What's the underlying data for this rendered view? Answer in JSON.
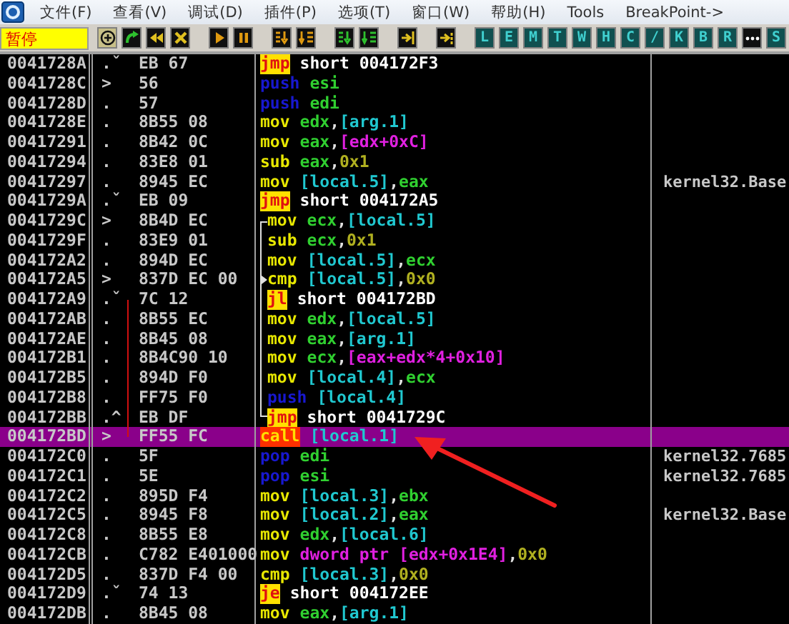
{
  "menu": [
    "文件(F)",
    "查看(V)",
    "调试(D)",
    "插件(P)",
    "选项(T)",
    "窗口(W)",
    "帮助(H)",
    "Tools",
    "BreakPoint->"
  ],
  "status": "暂停",
  "toolbar_letters": [
    {
      "kind": "letter",
      "label": "L"
    },
    {
      "kind": "letter",
      "label": "E"
    },
    {
      "kind": "letter",
      "label": "M"
    },
    {
      "kind": "letter",
      "label": "T"
    },
    {
      "kind": "letter",
      "label": "W"
    },
    {
      "kind": "letter",
      "label": "H"
    },
    {
      "kind": "letter",
      "label": "C"
    },
    {
      "kind": "letter",
      "label": "/"
    },
    {
      "kind": "letter",
      "label": "K"
    },
    {
      "kind": "letter",
      "label": "B"
    },
    {
      "kind": "letter",
      "label": "R"
    },
    {
      "kind": "dots"
    },
    {
      "kind": "letter",
      "label": "S"
    }
  ],
  "rows": [
    {
      "address": "0041728A",
      "marker": ".ˇ",
      "hex": "EB 67",
      "mnemonic": {
        "text": "jmp",
        "kind": "jump"
      },
      "operands": [
        {
          "text": "short 004172F3",
          "kind": "addr"
        }
      ],
      "selected": false
    },
    {
      "address": "0041728C",
      "marker": ">",
      "hex": "56",
      "mnemonic": {
        "text": "push",
        "kind": "stack"
      },
      "operands": [
        {
          "text": "esi",
          "kind": "reg"
        }
      ],
      "selected": false
    },
    {
      "address": "0041728D",
      "marker": ".",
      "hex": "57",
      "mnemonic": {
        "text": "push",
        "kind": "stack"
      },
      "operands": [
        {
          "text": "edi",
          "kind": "reg"
        }
      ],
      "selected": false
    },
    {
      "address": "0041728E",
      "marker": ".",
      "hex": "8B55 08",
      "mnemonic": {
        "text": "mov",
        "kind": "plain"
      },
      "operands": [
        {
          "text": "edx",
          "kind": "reg"
        },
        {
          "text": ",",
          "kind": "punct"
        },
        {
          "text": "[arg.1]",
          "kind": "mem"
        }
      ],
      "selected": false
    },
    {
      "address": "00417291",
      "marker": ".",
      "hex": "8B42 0C",
      "mnemonic": {
        "text": "mov",
        "kind": "plain"
      },
      "operands": [
        {
          "text": "eax",
          "kind": "reg"
        },
        {
          "text": ",",
          "kind": "punct"
        },
        {
          "text": "[edx+0xC]",
          "kind": "ptr"
        }
      ],
      "selected": false
    },
    {
      "address": "00417294",
      "marker": ".",
      "hex": "83E8 01",
      "mnemonic": {
        "text": "sub",
        "kind": "plain"
      },
      "operands": [
        {
          "text": "eax",
          "kind": "reg"
        },
        {
          "text": ",",
          "kind": "punct"
        },
        {
          "text": "0x1",
          "kind": "imm"
        }
      ],
      "selected": false
    },
    {
      "address": "00417297",
      "marker": ".",
      "hex": "8945 EC",
      "mnemonic": {
        "text": "mov",
        "kind": "plain"
      },
      "operands": [
        {
          "text": "[local.5]",
          "kind": "mem"
        },
        {
          "text": ",",
          "kind": "punct"
        },
        {
          "text": "eax",
          "kind": "reg"
        }
      ],
      "comment": "kernel32.Base",
      "selected": false
    },
    {
      "address": "0041729A",
      "marker": ".ˇ",
      "hex": "EB 09",
      "mnemonic": {
        "text": "jmp",
        "kind": "jump"
      },
      "operands": [
        {
          "text": "short 004172A5",
          "kind": "addr"
        }
      ],
      "selected": false
    },
    {
      "address": "0041729C",
      "marker": ">",
      "hex": "8B4D EC",
      "bracket": {
        "kind": "top"
      },
      "mnemonic": {
        "text": "mov",
        "kind": "plain"
      },
      "operands": [
        {
          "text": "ecx",
          "kind": "reg"
        },
        {
          "text": ",",
          "kind": "punct"
        },
        {
          "text": "[local.5]",
          "kind": "mem"
        }
      ],
      "selected": false
    },
    {
      "address": "0041729F",
      "marker": ".",
      "hex": "83E9 01",
      "bracket": {
        "kind": "mid"
      },
      "mnemonic": {
        "text": "sub",
        "kind": "plain"
      },
      "operands": [
        {
          "text": "ecx",
          "kind": "reg"
        },
        {
          "text": ",",
          "kind": "punct"
        },
        {
          "text": "0x1",
          "kind": "imm"
        }
      ],
      "selected": false
    },
    {
      "address": "004172A2",
      "marker": ".",
      "hex": "894D EC",
      "bracket": {
        "kind": "mid"
      },
      "mnemonic": {
        "text": "mov",
        "kind": "plain"
      },
      "operands": [
        {
          "text": "[local.5]",
          "kind": "mem"
        },
        {
          "text": ",",
          "kind": "punct"
        },
        {
          "text": "ecx",
          "kind": "reg"
        }
      ],
      "selected": false
    },
    {
      "address": "004172A5",
      "marker": ">",
      "hex": "837D EC 00",
      "bracket": {
        "kind": "target"
      },
      "mnemonic": {
        "text": "cmp",
        "kind": "plain"
      },
      "operands": [
        {
          "text": "[local.5]",
          "kind": "mem"
        },
        {
          "text": ",",
          "kind": "punct"
        },
        {
          "text": "0x0",
          "kind": "imm"
        }
      ],
      "selected": false
    },
    {
      "address": "004172A9",
      "marker": ".ˇ",
      "hex": "7C 12",
      "jump_line": {
        "kind": "start"
      },
      "bracket": {
        "kind": "mid"
      },
      "mnemonic": {
        "text": "jl",
        "kind": "jump"
      },
      "operands": [
        {
          "text": "short 004172BD",
          "kind": "addr"
        }
      ],
      "selected": false
    },
    {
      "address": "004172AB",
      "marker": ".",
      "hex": "8B55 EC",
      "jump_line": {
        "kind": "mid"
      },
      "bracket": {
        "kind": "mid"
      },
      "mnemonic": {
        "text": "mov",
        "kind": "plain"
      },
      "operands": [
        {
          "text": "edx",
          "kind": "reg"
        },
        {
          "text": ",",
          "kind": "punct"
        },
        {
          "text": "[local.5]",
          "kind": "mem"
        }
      ],
      "selected": false
    },
    {
      "address": "004172AE",
      "marker": ".",
      "hex": "8B45 08",
      "jump_line": {
        "kind": "mid"
      },
      "bracket": {
        "kind": "mid"
      },
      "mnemonic": {
        "text": "mov",
        "kind": "plain"
      },
      "operands": [
        {
          "text": "eax",
          "kind": "reg"
        },
        {
          "text": ",",
          "kind": "punct"
        },
        {
          "text": "[arg.1]",
          "kind": "mem"
        }
      ],
      "selected": false
    },
    {
      "address": "004172B1",
      "marker": ".",
      "hex": "8B4C90 10",
      "jump_line": {
        "kind": "mid"
      },
      "bracket": {
        "kind": "mid"
      },
      "mnemonic": {
        "text": "mov",
        "kind": "plain"
      },
      "operands": [
        {
          "text": "ecx",
          "kind": "reg"
        },
        {
          "text": ",",
          "kind": "punct"
        },
        {
          "text": "[eax+edx*4+0x10]",
          "kind": "ptr"
        }
      ],
      "selected": false
    },
    {
      "address": "004172B5",
      "marker": ".",
      "hex": "894D F0",
      "jump_line": {
        "kind": "mid"
      },
      "bracket": {
        "kind": "mid"
      },
      "mnemonic": {
        "text": "mov",
        "kind": "plain"
      },
      "operands": [
        {
          "text": "[local.4]",
          "kind": "mem"
        },
        {
          "text": ",",
          "kind": "punct"
        },
        {
          "text": "ecx",
          "kind": "reg"
        }
      ],
      "selected": false
    },
    {
      "address": "004172B8",
      "marker": ".",
      "hex": "FF75 F0",
      "jump_line": {
        "kind": "mid"
      },
      "bracket": {
        "kind": "mid"
      },
      "mnemonic": {
        "text": "push",
        "kind": "stack"
      },
      "operands": [
        {
          "text": "[local.4]",
          "kind": "mem"
        }
      ],
      "selected": false
    },
    {
      "address": "004172BB",
      "marker": ".^",
      "hex": "EB DF",
      "jump_line": {
        "kind": "mid"
      },
      "bracket": {
        "kind": "bottom"
      },
      "mnemonic": {
        "text": "jmp",
        "kind": "jump"
      },
      "operands": [
        {
          "text": "short 0041729C",
          "kind": "addr"
        }
      ],
      "selected": false
    },
    {
      "address": "004172BD",
      "marker": ">",
      "hex": "FF55 FC",
      "jump_line": {
        "kind": "end"
      },
      "mnemonic": {
        "text": "call",
        "kind": "call"
      },
      "operands": [
        {
          "text": "[local.1]",
          "kind": "mem"
        }
      ],
      "selected": true
    },
    {
      "address": "004172C0",
      "marker": ".",
      "hex": "5F",
      "mnemonic": {
        "text": "pop",
        "kind": "stack"
      },
      "operands": [
        {
          "text": "edi",
          "kind": "reg"
        }
      ],
      "comment": "kernel32.7685",
      "selected": false
    },
    {
      "address": "004172C1",
      "marker": ".",
      "hex": "5E",
      "mnemonic": {
        "text": "pop",
        "kind": "stack"
      },
      "operands": [
        {
          "text": "esi",
          "kind": "reg"
        }
      ],
      "comment": "kernel32.7685",
      "selected": false
    },
    {
      "address": "004172C2",
      "marker": ".",
      "hex": "895D F4",
      "mnemonic": {
        "text": "mov",
        "kind": "plain"
      },
      "operands": [
        {
          "text": "[local.3]",
          "kind": "mem"
        },
        {
          "text": ",",
          "kind": "punct"
        },
        {
          "text": "ebx",
          "kind": "reg"
        }
      ],
      "selected": false
    },
    {
      "address": "004172C5",
      "marker": ".",
      "hex": "8945 F8",
      "mnemonic": {
        "text": "mov",
        "kind": "plain"
      },
      "operands": [
        {
          "text": "[local.2]",
          "kind": "mem"
        },
        {
          "text": ",",
          "kind": "punct"
        },
        {
          "text": "eax",
          "kind": "reg"
        }
      ],
      "comment": "kernel32.Base",
      "selected": false
    },
    {
      "address": "004172C8",
      "marker": ".",
      "hex": "8B55 E8",
      "mnemonic": {
        "text": "mov",
        "kind": "plain"
      },
      "operands": [
        {
          "text": "edx",
          "kind": "reg"
        },
        {
          "text": ",",
          "kind": "punct"
        },
        {
          "text": "[local.6]",
          "kind": "mem"
        }
      ],
      "selected": false
    },
    {
      "address": "004172CB",
      "marker": ".",
      "hex": "C782 E401000",
      "mnemonic": {
        "text": "mov",
        "kind": "plain"
      },
      "operands": [
        {
          "text": "dword ptr [edx+0x1E4]",
          "kind": "ptr"
        },
        {
          "text": ",",
          "kind": "punct"
        },
        {
          "text": "0x0",
          "kind": "imm"
        }
      ],
      "selected": false
    },
    {
      "address": "004172D5",
      "marker": ".",
      "hex": "837D F4 00",
      "mnemonic": {
        "text": "cmp",
        "kind": "plain"
      },
      "operands": [
        {
          "text": "[local.3]",
          "kind": "mem"
        },
        {
          "text": ",",
          "kind": "punct"
        },
        {
          "text": "0x0",
          "kind": "imm"
        }
      ],
      "selected": false
    },
    {
      "address": "004172D9",
      "marker": ".ˇ",
      "hex": "74 13",
      "mnemonic": {
        "text": "je",
        "kind": "jump"
      },
      "operands": [
        {
          "text": "short 004172EE",
          "kind": "addr"
        }
      ],
      "selected": false
    },
    {
      "address": "004172DB",
      "marker": ".",
      "hex": "8B45 08",
      "mnemonic": {
        "text": "mov",
        "kind": "plain"
      },
      "operands": [
        {
          "text": "eax",
          "kind": "reg"
        },
        {
          "text": ",",
          "kind": "punct"
        },
        {
          "text": "[arg.1]",
          "kind": "mem"
        }
      ],
      "selected": false
    }
  ]
}
